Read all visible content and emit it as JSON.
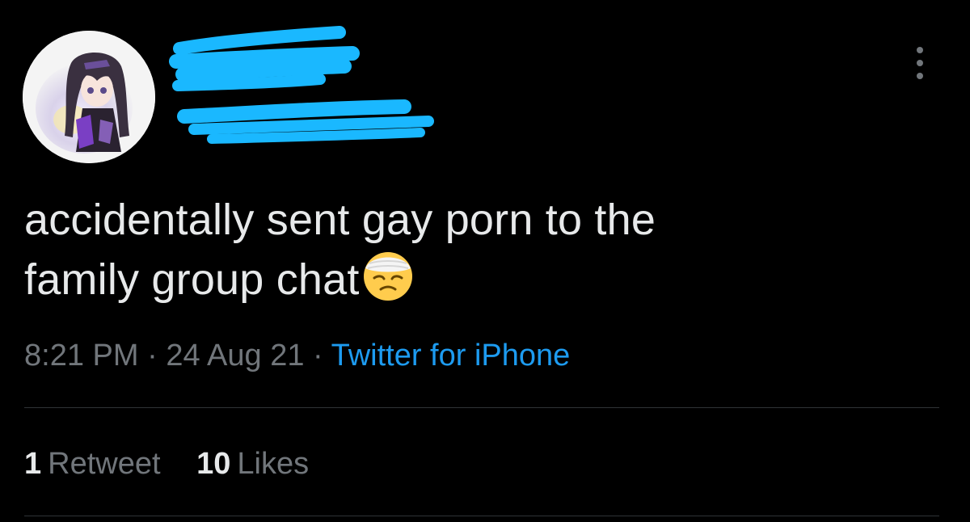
{
  "tweet": {
    "text_line1": "accidentally sent gay porn to the",
    "text_line2": "family group chat",
    "emoji": "face-with-head-bandage-emoji"
  },
  "meta": {
    "time": "8:21 PM",
    "separator": "·",
    "date": "24 Aug 21",
    "source": "Twitter for iPhone"
  },
  "stats": {
    "retweets_count": "1",
    "retweets_label": "Retweet",
    "likes_count": "10",
    "likes_label": "Likes"
  },
  "icons": {
    "more": "more-horizontal-icon",
    "avatar": "anime-character-avatar"
  },
  "colors": {
    "background": "#000000",
    "text": "#e7e9ea",
    "muted": "#71767b",
    "link": "#1d9bf0",
    "redaction": "#1ab8ff",
    "divider": "#2f3336"
  }
}
